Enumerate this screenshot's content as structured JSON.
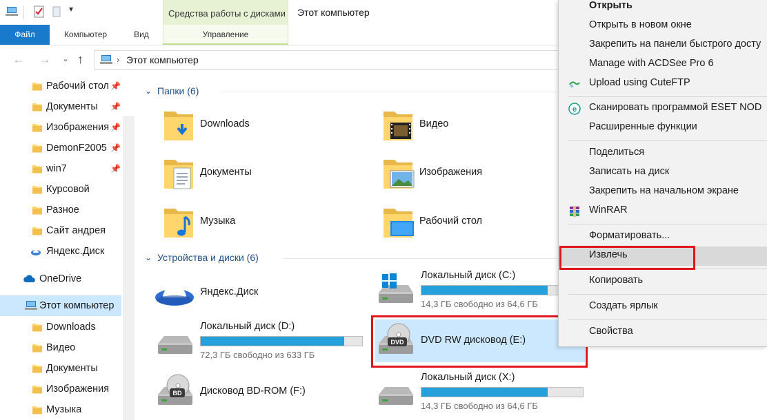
{
  "window": {
    "title": "Этот компьютер",
    "tools_tab": "Средства работы с дисками"
  },
  "ribbon": {
    "tabs": [
      {
        "label": "Файл"
      },
      {
        "label": "Компьютер"
      },
      {
        "label": "Вид"
      },
      {
        "label": "Управление"
      }
    ]
  },
  "address": {
    "path": "Этот компьютер"
  },
  "nav": {
    "quick_access": [
      {
        "label": "Рабочий стол",
        "pinned": true
      },
      {
        "label": "Документы",
        "pinned": true
      },
      {
        "label": "Изображения",
        "pinned": true
      },
      {
        "label": "DemonF2005",
        "pinned": true
      },
      {
        "label": "win7",
        "pinned": true
      },
      {
        "label": "Курсовой"
      },
      {
        "label": "Разное"
      },
      {
        "label": "Сайт андрея"
      },
      {
        "label": "Яндекс.Диск"
      }
    ],
    "onedrive": "OneDrive",
    "this_pc": "Этот компьютер",
    "this_pc_children": [
      {
        "label": "Downloads"
      },
      {
        "label": "Видео"
      },
      {
        "label": "Документы"
      },
      {
        "label": "Изображения"
      },
      {
        "label": "Музыка"
      }
    ]
  },
  "content": {
    "folders_header": "Папки (6)",
    "folders": [
      {
        "label": "Downloads"
      },
      {
        "label": "Видео"
      },
      {
        "label": "Документы"
      },
      {
        "label": "Изображения"
      },
      {
        "label": "Музыка"
      },
      {
        "label": "Рабочий стол"
      }
    ],
    "devices_header": "Устройства и диски (6)",
    "devices": [
      {
        "name": "Яндекс.Диск"
      },
      {
        "name": "Локальный диск (C:)",
        "free": "14,3 ГБ свободно из 64,6 ГБ",
        "used_fraction": 0.78
      },
      {
        "name": "Локальный диск (D:)",
        "free": "72,3 ГБ свободно из 633 ГБ",
        "used_fraction": 0.89
      },
      {
        "name": "DVD RW дисковод (E:)",
        "badge": "DVD"
      },
      {
        "name": "Дисковод BD-ROM (F:)",
        "badge": "BD"
      },
      {
        "name": "Локальный диск (X:)",
        "free": "14,3 ГБ свободно из 64,6 ГБ",
        "used_fraction": 0.78
      }
    ]
  },
  "context_menu": {
    "items": [
      {
        "label": "Открыть"
      },
      {
        "label": "Открыть в новом окне"
      },
      {
        "label": "Закрепить на панели быстрого досту"
      },
      {
        "label": "Manage with ACDSee Pro 6"
      },
      {
        "label": "Upload using CuteFTP"
      },
      {
        "label": "Сканировать программой ESET NOD"
      },
      {
        "label": "Расширенные функции"
      },
      {
        "label": "Поделиться"
      },
      {
        "label": "Записать на диск"
      },
      {
        "label": "Закрепить на начальном экране"
      },
      {
        "label": "WinRAR"
      },
      {
        "label": "Форматировать..."
      },
      {
        "label": "Извлечь"
      },
      {
        "label": "Копировать"
      },
      {
        "label": "Создать ярлык"
      },
      {
        "label": "Свойства"
      }
    ]
  },
  "colors": {
    "accent": "#1979ca",
    "selection": "#cce8ff",
    "progress": "#26a0da",
    "highlight_box": "#e0161f",
    "tools_tab": "#e6f2d3"
  }
}
